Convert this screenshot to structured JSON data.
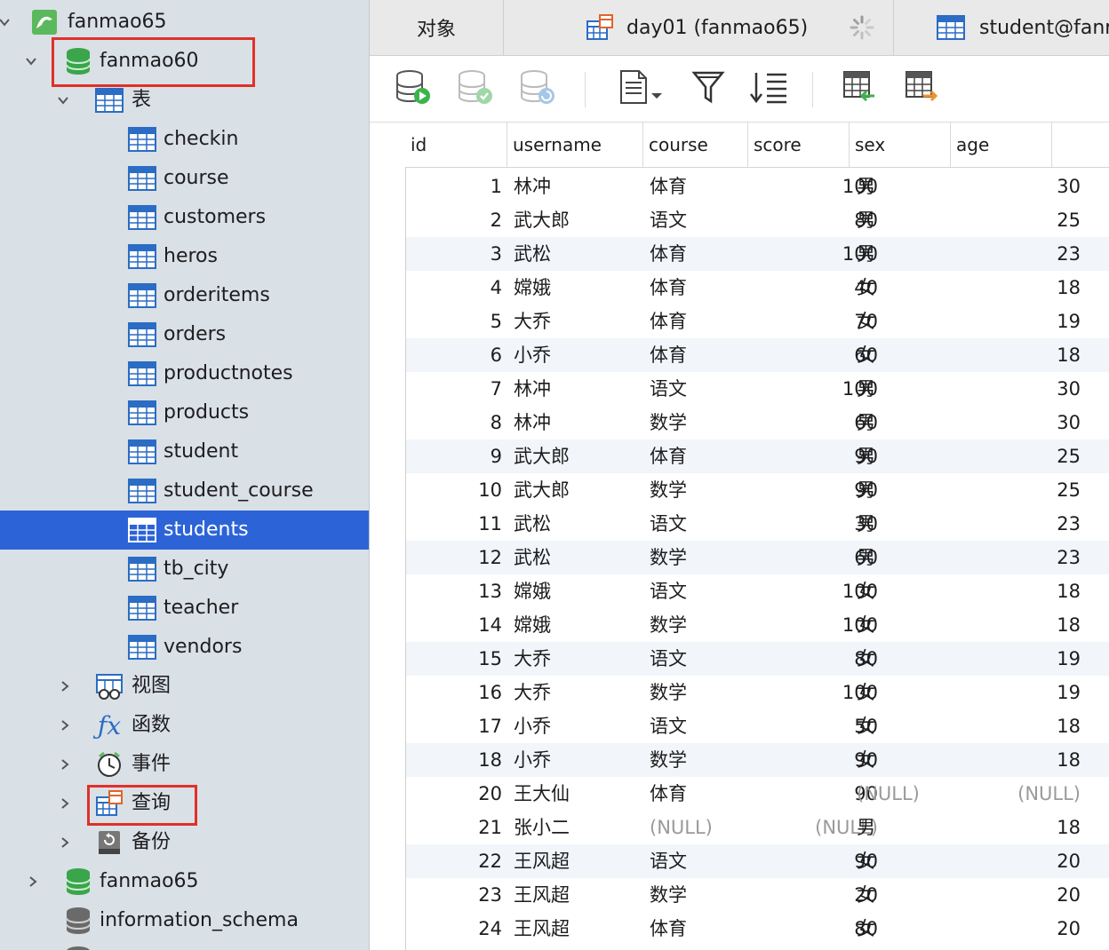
{
  "sidebar": {
    "connection": "fanmao65",
    "db_open": "fanmao60",
    "tables_group": "表",
    "tables": [
      "checkin",
      "course",
      "customers",
      "heros",
      "orderitems",
      "orders",
      "productnotes",
      "products",
      "student",
      "student_course",
      "students",
      "tb_city",
      "teacher",
      "vendors"
    ],
    "selected_table": "students",
    "groups": [
      "视图",
      "函数",
      "事件",
      "查询",
      "备份"
    ],
    "other_dbs": [
      "fanmao65",
      "information_schema"
    ]
  },
  "tabs": {
    "objects": "对象",
    "query": "day01 (fanmao65)",
    "table": "student@fanr"
  },
  "grid": {
    "columns": [
      "id",
      "username",
      "course",
      "score",
      "sex",
      "age"
    ],
    "null_text": "(NULL)",
    "rows": [
      [
        "1",
        "林冲",
        "体育",
        "100",
        "男",
        "30"
      ],
      [
        "2",
        "武大郎",
        "语文",
        "80",
        "男",
        "25"
      ],
      [
        "3",
        "武松",
        "体育",
        "100",
        "男",
        "23"
      ],
      [
        "4",
        "嫦娥",
        "体育",
        "40",
        "女",
        "18"
      ],
      [
        "5",
        "大乔",
        "体育",
        "70",
        "女",
        "19"
      ],
      [
        "6",
        "小乔",
        "体育",
        "60",
        "女",
        "18"
      ],
      [
        "7",
        "林冲",
        "语文",
        "100",
        "男",
        "30"
      ],
      [
        "8",
        "林冲",
        "数学",
        "60",
        "男",
        "30"
      ],
      [
        "9",
        "武大郎",
        "体育",
        "90",
        "男",
        "25"
      ],
      [
        "10",
        "武大郎",
        "数学",
        "90",
        "男",
        "25"
      ],
      [
        "11",
        "武松",
        "语文",
        "30",
        "男",
        "23"
      ],
      [
        "12",
        "武松",
        "数学",
        "60",
        "男",
        "23"
      ],
      [
        "13",
        "嫦娥",
        "语文",
        "100",
        "女",
        "18"
      ],
      [
        "14",
        "嫦娥",
        "数学",
        "100",
        "女",
        "18"
      ],
      [
        "15",
        "大乔",
        "语文",
        "80",
        "女",
        "19"
      ],
      [
        "16",
        "大乔",
        "数学",
        "100",
        "女",
        "19"
      ],
      [
        "17",
        "小乔",
        "语文",
        "50",
        "女",
        "18"
      ],
      [
        "18",
        "小乔",
        "数学",
        "90",
        "女",
        "18"
      ],
      [
        "20",
        "王大仙",
        "体育",
        "90",
        null,
        null
      ],
      [
        "21",
        "张小二",
        null,
        null,
        "男",
        "18"
      ],
      [
        "22",
        "王风超",
        "语文",
        "90",
        "女",
        "20"
      ],
      [
        "23",
        "王风超",
        "数学",
        "20",
        "女",
        "20"
      ],
      [
        "24",
        "王风超",
        "体育",
        "80",
        "女",
        "20"
      ]
    ]
  },
  "colors": {
    "selection": "#2c64d8",
    "highlight_box": "#e0302a",
    "sidebar_bg": "#d9e0e6"
  }
}
